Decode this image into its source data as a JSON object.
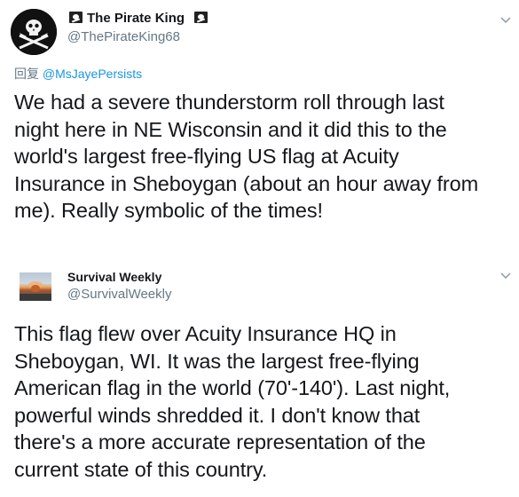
{
  "tweet1": {
    "display_name": "The Pirate King",
    "handle": "@ThePirateKing68",
    "reply_prefix": "回复",
    "reply_to": "@MsJayePersists",
    "text": "We had a severe thunderstorm roll through last\nnight here in NE Wisconsin and it did this to the\nworld's largest free-flying US flag at Acuity\nInsurance in Sheboygan (about an hour away from\nme). Really symbolic of the times!",
    "avatar_icon": "jolly-roger-icon",
    "name_icon": "pirate-flag-icon"
  },
  "tweet2": {
    "display_name": "Survival Weekly",
    "handle": "@SurvivalWeekly",
    "text": "This flag flew over Acuity Insurance HQ in\nSheboygan, WI. It was the largest free-flying\nAmerican flag in the world (70'-140'). Last night,\npowerful winds shredded it. I don't know that\nthere's a more accurate representation of the\ncurrent state of this country.",
    "avatar_icon": "explosion-avatar"
  },
  "colors": {
    "text": "#14171a",
    "secondary": "#657786",
    "link": "#1b95e0",
    "divider": "#e6ecf0"
  }
}
